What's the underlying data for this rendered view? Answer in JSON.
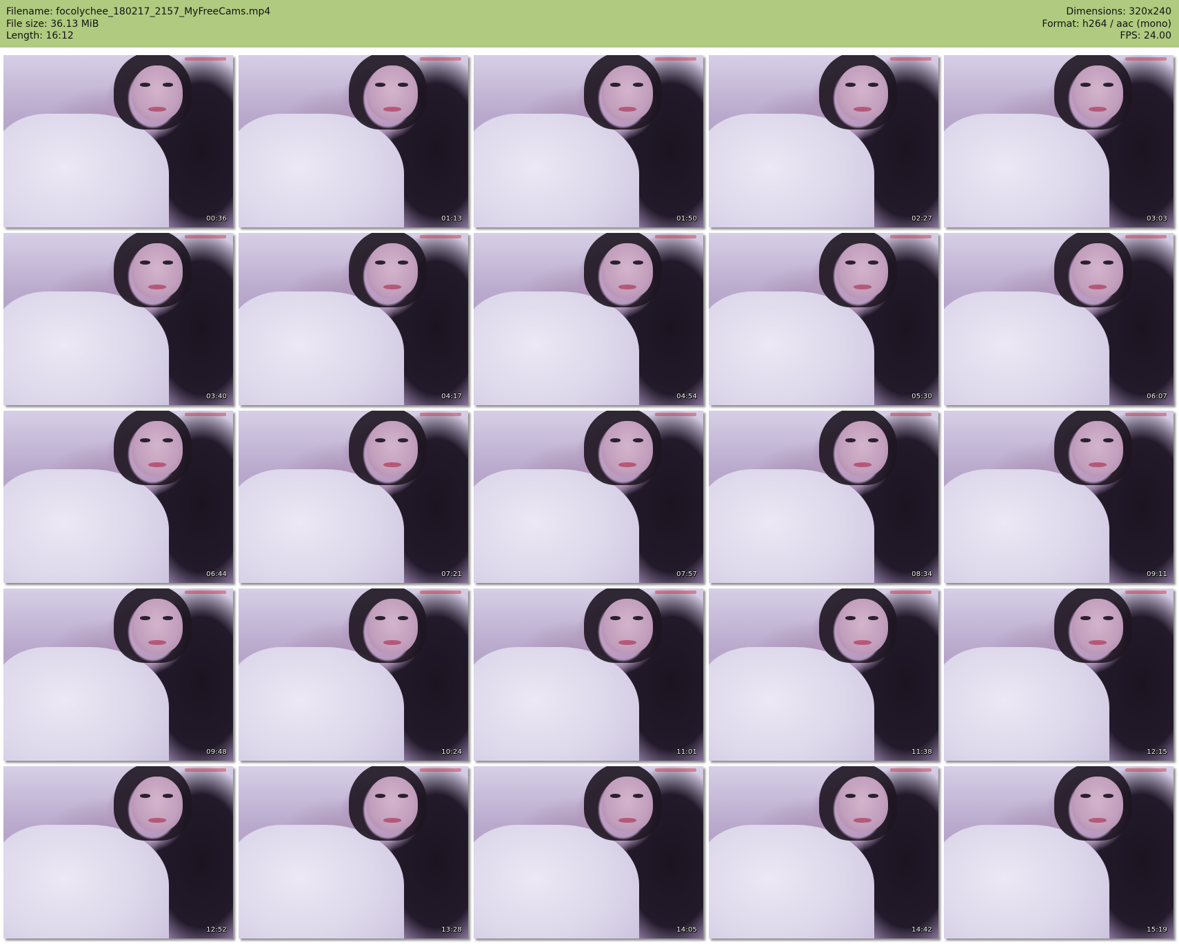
{
  "header": {
    "filename_line": "Filename: focolychee_180217_2157_MyFreeCams.mp4",
    "filesize_line": "File size: 36.13 MiB",
    "length_line": "Length: 16:12",
    "dimensions_line": "Dimensions: 320x240",
    "format_line": "Format: h264 / aac (mono)",
    "fps_line": "FPS: 24.00",
    "background_color": "#b0cb80"
  },
  "thumbnails": [
    {
      "timestamp": "00:36"
    },
    {
      "timestamp": "01:13"
    },
    {
      "timestamp": "01:50"
    },
    {
      "timestamp": "02:27"
    },
    {
      "timestamp": "03:03"
    },
    {
      "timestamp": "03:40"
    },
    {
      "timestamp": "04:17"
    },
    {
      "timestamp": "04:54"
    },
    {
      "timestamp": "05:30"
    },
    {
      "timestamp": "06:07"
    },
    {
      "timestamp": "06:44"
    },
    {
      "timestamp": "07:21"
    },
    {
      "timestamp": "07:57"
    },
    {
      "timestamp": "08:34"
    },
    {
      "timestamp": "09:11"
    },
    {
      "timestamp": "09:48"
    },
    {
      "timestamp": "10:24"
    },
    {
      "timestamp": "11:01"
    },
    {
      "timestamp": "11:38"
    },
    {
      "timestamp": "12:15"
    },
    {
      "timestamp": "12:52"
    },
    {
      "timestamp": "13:28"
    },
    {
      "timestamp": "14:05"
    },
    {
      "timestamp": "14:42"
    },
    {
      "timestamp": "15:19"
    }
  ]
}
